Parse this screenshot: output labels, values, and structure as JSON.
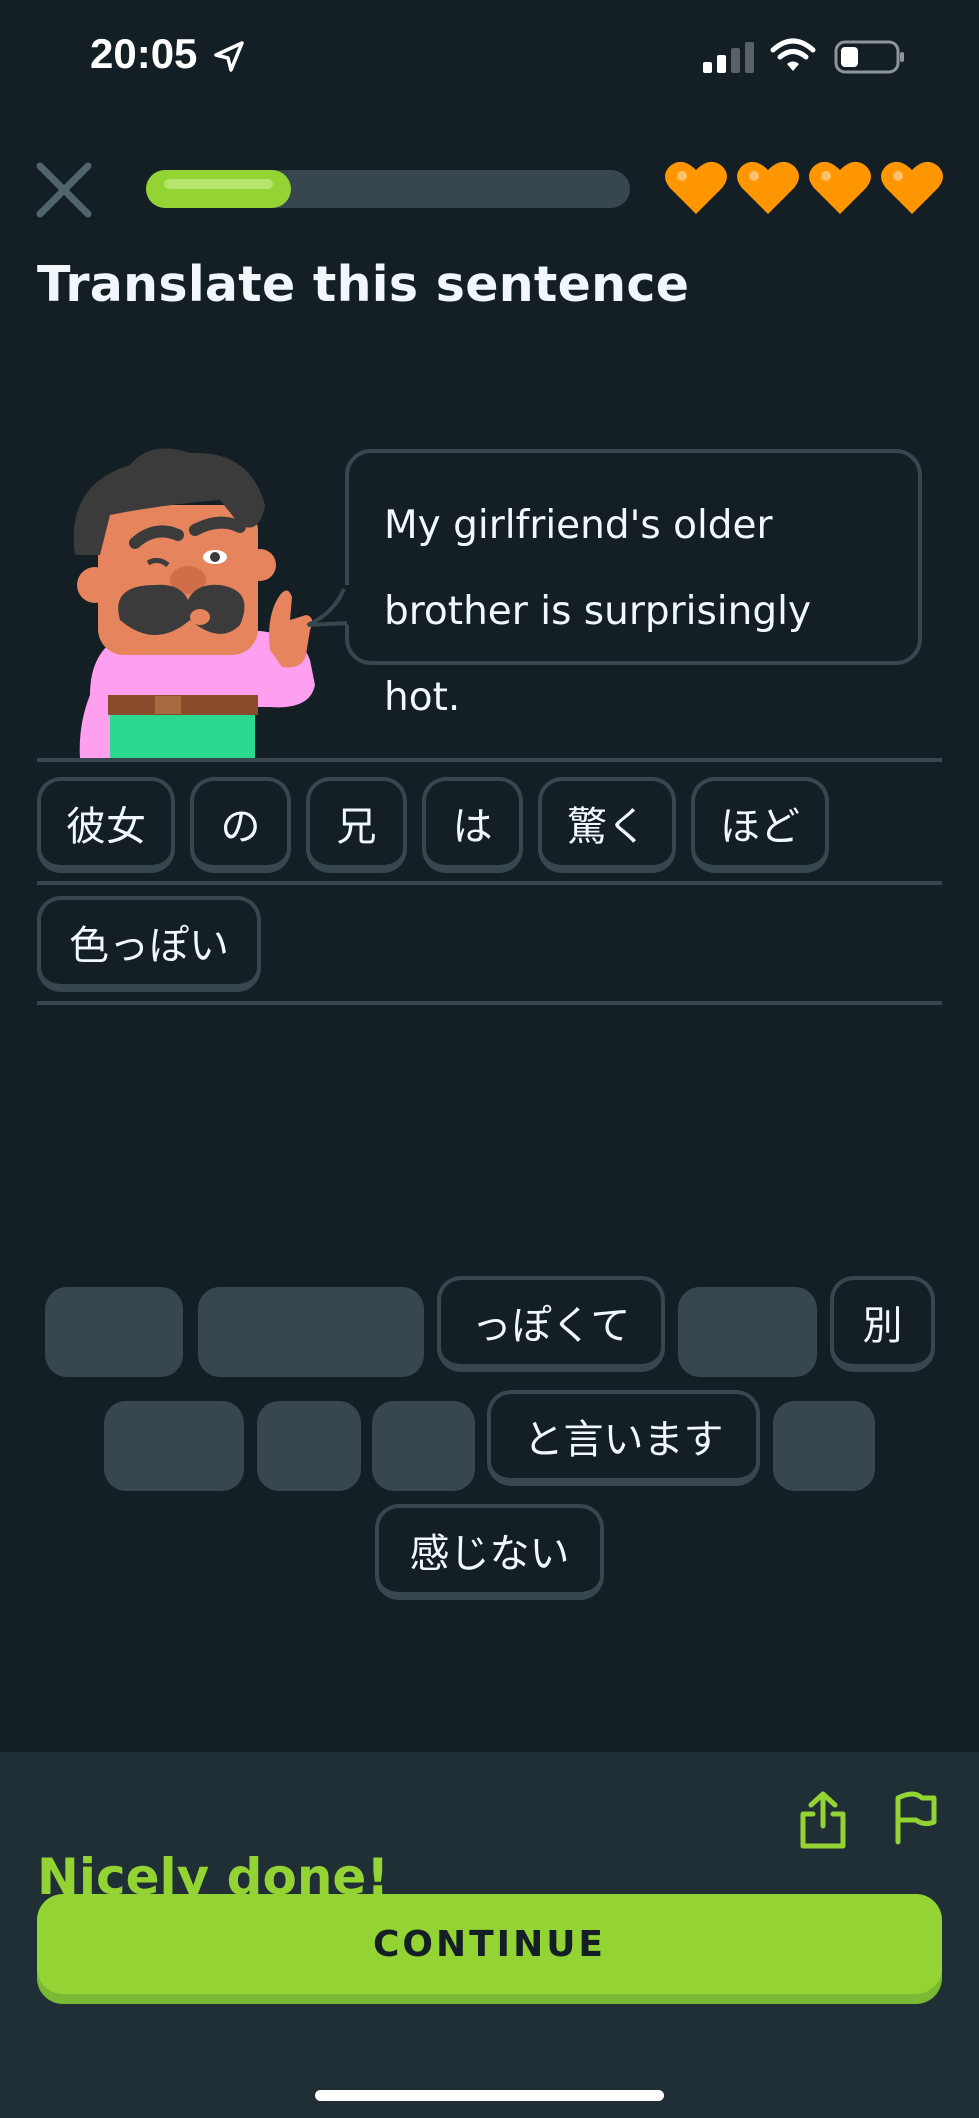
{
  "status_bar": {
    "time": "20:05",
    "location_icon": "location-arrow-icon",
    "signal_icon": "cellular-signal-icon",
    "wifi_icon": "wifi-icon",
    "battery_icon": "battery-icon"
  },
  "header": {
    "close_icon": "close-icon",
    "progress": 0.3,
    "hearts": 4,
    "heart_color": "#ff9600",
    "title": "Translate this sentence"
  },
  "prompt": {
    "character": "mustache-man-character",
    "sentence": "My girlfriend's older brother is surprisingly hot."
  },
  "answer": {
    "tiles": [
      "彼女",
      "の",
      "兄",
      "は",
      "驚く",
      "ほど",
      "色っぽい"
    ]
  },
  "word_bank": {
    "tiles": [
      "っぽくて",
      "別",
      "と言います",
      "感じない"
    ]
  },
  "feedback": {
    "title": "Nicely done!",
    "share_icon": "share-icon",
    "flag_icon": "flag-icon",
    "continue_label": "CONTINUE"
  },
  "colors": {
    "background": "#131f24",
    "tile_border": "#37464f",
    "accent_green": "#93d333",
    "feedback_bg": "#202f36"
  }
}
